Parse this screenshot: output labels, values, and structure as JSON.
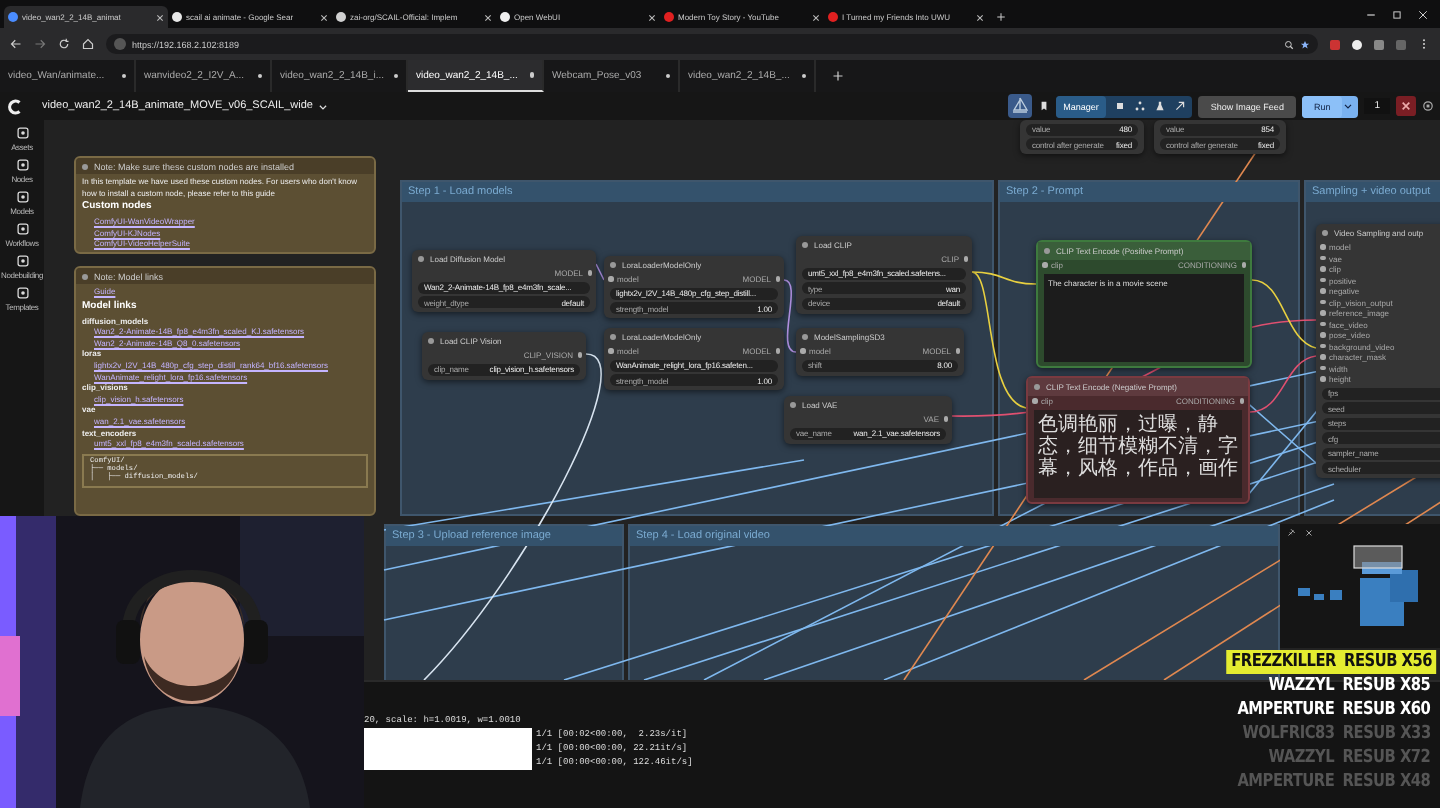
{
  "browser": {
    "tabs": [
      {
        "title": "video_wan2_2_14B_animat",
        "selected": true,
        "color": "#4a8cff"
      },
      {
        "title": "scail ai animate - Google Sear",
        "selected": false,
        "color": "#e8e8e8"
      },
      {
        "title": "zai-org/SCAIL-Official: Implem",
        "selected": false,
        "color": "#d0d0d0"
      },
      {
        "title": "Open WebUI",
        "selected": false,
        "color": "#f0f0f0"
      },
      {
        "title": "Modern Toy Story - YouTube",
        "selected": false,
        "color": "#e02020"
      },
      {
        "title": "I Turned my Friends Into UWU",
        "selected": false,
        "color": "#e02020"
      }
    ],
    "address": "https://192.168.2.102:8189"
  },
  "workflow_tabs": [
    {
      "label": "video_Wan/animate...",
      "selected": false
    },
    {
      "label": "wanvideo2_2_I2V_A...",
      "selected": false
    },
    {
      "label": "video_wan2_2_14B_i...",
      "selected": false
    },
    {
      "label": "video_wan2_2_14B_...",
      "selected": true
    },
    {
      "label": "Webcam_Pose_v03",
      "selected": false
    },
    {
      "label": "video_wan2_2_14B_...",
      "selected": false
    }
  ],
  "toolbar": {
    "title": "video_wan2_2_14B_animate_MOVE_v06_SCAIL_wide",
    "manager": "Manager",
    "image_feed": "Show Image Feed",
    "run": "Run",
    "batch_count": "1"
  },
  "sidebar": [
    {
      "label": "Assets"
    },
    {
      "label": "Nodes"
    },
    {
      "label": "Models"
    },
    {
      "label": "Workflows"
    },
    {
      "label": "Nodebuilding"
    },
    {
      "label": "Templates"
    }
  ],
  "notes": [
    {
      "title": "Note: Make sure these custom nodes are installed",
      "blocks": [
        {
          "kind": "text",
          "text": "In this template we have used these custom nodes. For users who don't know how to install a custom node, please refer to this guide"
        },
        {
          "kind": "heading",
          "text": "Custom nodes"
        },
        {
          "kind": "link",
          "text": "ComfyUI-WanVideoWrapper"
        },
        {
          "kind": "link",
          "text": "ComfyUI-KJNodes"
        },
        {
          "kind": "link",
          "text": "ComfyUI-VideoHelperSuite"
        }
      ]
    },
    {
      "title": "Note: Model links",
      "blocks": [
        {
          "kind": "link",
          "text": "Guide"
        },
        {
          "kind": "heading",
          "text": "Model links"
        },
        {
          "kind": "label",
          "text": "diffusion_models"
        },
        {
          "kind": "link",
          "text": "Wan2_2-Animate-14B_fp8_e4m3fn_scaled_KJ.safetensors"
        },
        {
          "kind": "link",
          "text": "Wan2_2-Animate-14B_Q8_0.safetensors"
        },
        {
          "kind": "label",
          "text": "loras"
        },
        {
          "kind": "link",
          "text": "lightx2v_I2V_14B_480p_cfg_step_distill_rank64_bf16.safetensors"
        },
        {
          "kind": "link",
          "text": "WanAnimate_relight_lora_fp16.safetensors"
        },
        {
          "kind": "label",
          "text": "clip_visions"
        },
        {
          "kind": "link",
          "text": "clip_vision_h.safetensors"
        },
        {
          "kind": "label",
          "text": "vae"
        },
        {
          "kind": "link",
          "text": "wan_2.1_vae.safetensors"
        },
        {
          "kind": "label",
          "text": "text_encoders"
        },
        {
          "kind": "link",
          "text": "umt5_xxl_fp8_e4m3fn_scaled.safetensors"
        },
        {
          "kind": "code",
          "text": "ComfyUI/\n├── models/\n│   ├── diffusion_models/"
        }
      ]
    }
  ],
  "groups": [
    {
      "title": "Step 1 - Load models"
    },
    {
      "title": "Step 2 - Prompt"
    },
    {
      "title": "Sampling + video output"
    },
    {
      "title": "Step 3 - Upload reference image"
    },
    {
      "title": "Step 4 - Load original video"
    }
  ],
  "nodes": [
    {
      "kind": "plain",
      "title": "Load Diffusion Model",
      "outputs": [
        "MODEL"
      ],
      "widgets": [
        {
          "value": "Wan2_2-Animate-14B_fp8_e4m3fn_scale..."
        },
        {
          "name": "weight_dtype",
          "value": "default"
        }
      ]
    },
    {
      "kind": "plain",
      "title": "LoraLoaderModelOnly",
      "inputs": [
        "model"
      ],
      "outputs": [
        "MODEL"
      ],
      "widgets": [
        {
          "value": "lightx2v_I2V_14B_480p_cfg_step_distill..."
        },
        {
          "name": "strength_model",
          "value": "1.00"
        }
      ]
    },
    {
      "kind": "plain",
      "title": "Load CLIP",
      "outputs": [
        "CLIP"
      ],
      "widgets": [
        {
          "value": "umt5_xxl_fp8_e4m3fn_scaled.safetens..."
        },
        {
          "name": "type",
          "value": "wan"
        },
        {
          "name": "device",
          "value": "default"
        }
      ]
    },
    {
      "kind": "plain",
      "title": "Load CLIP Vision",
      "outputs": [
        "CLIP_VISION"
      ],
      "widgets": [
        {
          "name": "clip_name",
          "value": "clip_vision_h.safetensors"
        }
      ]
    },
    {
      "kind": "plain",
      "title": "LoraLoaderModelOnly",
      "inputs": [
        "model"
      ],
      "outputs": [
        "MODEL"
      ],
      "widgets": [
        {
          "value": "WanAnimate_relight_lora_fp16.safeten..."
        },
        {
          "name": "strength_model",
          "value": "1.00"
        }
      ]
    },
    {
      "kind": "plain",
      "title": "ModelSamplingSD3",
      "inputs": [
        "model"
      ],
      "outputs": [
        "MODEL"
      ],
      "widgets": [
        {
          "name": "shift",
          "value": "8.00"
        }
      ]
    },
    {
      "kind": "plain",
      "title": "Load VAE",
      "outputs": [
        "VAE"
      ],
      "widgets": [
        {
          "name": "vae_name",
          "value": "wan_2.1_vae.safetensors"
        }
      ]
    },
    {
      "kind": "positive",
      "title": "CLIP Text Encode (Positive Prompt)",
      "inputs": [
        "clip"
      ],
      "outputs": [
        "CONDITIONING"
      ],
      "text": "The character is in a movie scene"
    },
    {
      "kind": "negative",
      "title": "CLIP Text Encode (Negative Prompt)",
      "inputs": [
        "clip"
      ],
      "outputs": [
        "CONDITIONING"
      ],
      "text": "色调艳丽，过曝，静态，细节模糊不清，字幕，风格，作品，画作"
    },
    {
      "kind": "plain",
      "title": "Video Sampling and outp",
      "inputs": [
        "model",
        "vae",
        "clip",
        "positive",
        "negative",
        "clip_vision_output",
        "reference_image",
        "face_video",
        "pose_video",
        "background_video",
        "character_mask",
        "width",
        "height"
      ],
      "widgets": [
        {
          "name": "fps"
        },
        {
          "name": "seed"
        },
        {
          "name": "steps"
        },
        {
          "name": "cfg"
        },
        {
          "name": "sampler_name"
        },
        {
          "name": "scheduler"
        }
      ]
    },
    {
      "kind": "plain",
      "widgets": [
        {
          "name": "value",
          "value": "480"
        },
        {
          "name": "control after generate",
          "value": "fixed"
        }
      ]
    },
    {
      "kind": "plain",
      "widgets": [
        {
          "name": "value",
          "value": "854"
        },
        {
          "name": "control after generate",
          "value": "fixed"
        }
      ]
    }
  ],
  "terminal": {
    "lines": [
      {
        "text": "20, scale: h=1.0019, w=1.0010",
        "redacted": false
      },
      {
        "text": "1/1 [00:02<00:00,  2.23s/it]",
        "redacted": true
      },
      {
        "text": "1/1 [00:00<00:00, 22.21it/s]",
        "redacted": true
      },
      {
        "text": "1/1 [00:00<00:00, 122.46it/s]",
        "redacted": true
      }
    ]
  },
  "alerts": [
    {
      "name": "FREZZKILLER",
      "count": "RESUB X56",
      "highlighted": true,
      "dimmed": false
    },
    {
      "name": "WAZZYL",
      "count": "RESUB X85",
      "highlighted": false,
      "dimmed": false
    },
    {
      "name": "AMPERTURE",
      "count": "RESUB X60",
      "highlighted": false,
      "dimmed": false
    },
    {
      "name": "WOLFRIC83",
      "count": "RESUB X33",
      "highlighted": false,
      "dimmed": true
    },
    {
      "name": "WAZZYL",
      "count": "RESUB X72",
      "highlighted": false,
      "dimmed": true
    },
    {
      "name": "AMPERTURE",
      "count": "RESUB X48",
      "highlighted": false,
      "dimmed": true
    }
  ]
}
